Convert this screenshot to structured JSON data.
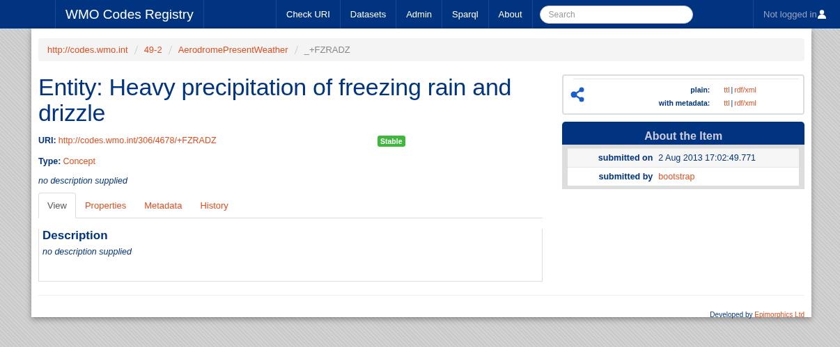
{
  "navbar": {
    "brand": "WMO Codes Registry",
    "links": [
      "Check URI",
      "Datasets",
      "Admin",
      "Sparql",
      "About"
    ],
    "search": {
      "placeholder": "Search"
    },
    "login": "Not logged in"
  },
  "breadcrumb": [
    {
      "label": "http://codes.wmo.int",
      "link": true
    },
    {
      "label": "49-2",
      "link": true
    },
    {
      "label": "AerodromePresentWeather",
      "link": true
    },
    {
      "label": "_+FZRADZ",
      "link": false
    }
  ],
  "entity": {
    "title": "Entity: Heavy precipitation of freezing rain and drizzle",
    "uri_label": "URI:",
    "uri": "http://codes.wmo.int/306/4678/+FZRADZ",
    "status": "Stable",
    "type_label": "Type:",
    "type": "Concept",
    "description": "no description supplied"
  },
  "tabs": [
    {
      "label": "View",
      "selected": true
    },
    {
      "label": "Properties",
      "selected": false
    },
    {
      "label": "Metadata",
      "selected": false
    },
    {
      "label": "History",
      "selected": false
    }
  ],
  "tab_panel": {
    "heading": "Description",
    "text": "no description supplied"
  },
  "downloads": [
    {
      "label": "plain:",
      "formats": [
        "ttl",
        "rdf/xml"
      ],
      "separator": "|"
    },
    {
      "label": "with metadata:",
      "formats": [
        "ttl",
        "rdf/xml"
      ],
      "separator": "|"
    }
  ],
  "about": {
    "title": "About the Item",
    "rows": [
      {
        "label": "submitted on",
        "value": "2 Aug 2013 17:02:49.771",
        "kind": "text"
      },
      {
        "label": "submitted by",
        "value": "bootstrap",
        "kind": "link"
      }
    ]
  },
  "footer": {
    "prefix": "Developed by",
    "link": "Epimorphics Ltd"
  }
}
